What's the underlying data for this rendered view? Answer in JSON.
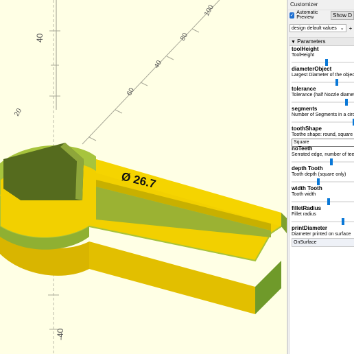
{
  "viewport": {
    "axis_labels": [
      "40",
      "40",
      "60",
      "80",
      "100",
      "120",
      "-40",
      "20"
    ],
    "model_label": "Ø 26.7"
  },
  "customizer": {
    "title": "Customizer",
    "auto_preview_label": "Automatic Preview",
    "show_button_label": "Show D",
    "preset_value": "design default values",
    "preset_arrow": "⌄",
    "plus_label": "+",
    "parameters_header": "Parameters",
    "params": [
      {
        "name": "toolHeight",
        "desc": "ToolHeight",
        "control": "slider",
        "level": 0.55
      },
      {
        "name": "diameterObject",
        "desc": "Largest Diameter of the object",
        "control": "slider",
        "level": 0.72
      },
      {
        "name": "tolerance",
        "desc": "Tolerance (half Nozzle diameter)",
        "control": "slider",
        "level": 0.88
      },
      {
        "name": "segments",
        "desc": "Number of Segments in a circle",
        "control": "slider",
        "level": 1.0
      },
      {
        "name": "toothShape",
        "desc": "Toothe shape: round, square",
        "control": "select",
        "value": "Square"
      },
      {
        "name": "noTeeth",
        "desc": "Serrated edge, number of teeth",
        "control": "slider",
        "level": 0.63
      },
      {
        "name": "depth Tooth",
        "desc": "Tooth depth (square only)",
        "control": "slider",
        "level": 0.42
      },
      {
        "name": "width Tooth",
        "desc": "Tooth width",
        "control": "slider",
        "level": 0.58
      },
      {
        "name": "filletRadius",
        "desc": "Fillet radius",
        "control": "slider",
        "level": 0.82
      },
      {
        "name": "printDiameter",
        "desc": "Diameter printed on surface",
        "control": "select2",
        "value": "OnSurface"
      }
    ]
  }
}
